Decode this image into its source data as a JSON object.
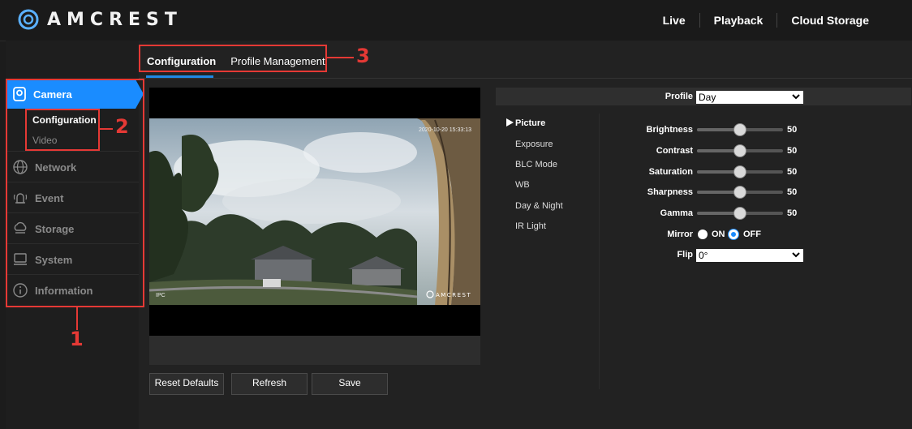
{
  "brand": {
    "name": "AMCREST"
  },
  "topnav": [
    {
      "label": "Live"
    },
    {
      "label": "Playback"
    },
    {
      "label": "Cloud Storage"
    }
  ],
  "subtabs": [
    {
      "label": "Configuration"
    },
    {
      "label": "Profile Management"
    }
  ],
  "sidebar": {
    "active": {
      "label": "Camera",
      "icon": "camera-icon"
    },
    "submenu": [
      {
        "label": "Configuration"
      },
      {
        "label": "Video"
      }
    ],
    "items": [
      {
        "label": "Network",
        "icon": "network-icon"
      },
      {
        "label": "Event",
        "icon": "event-icon"
      },
      {
        "label": "Storage",
        "icon": "storage-icon"
      },
      {
        "label": "System",
        "icon": "system-icon"
      },
      {
        "label": "Information",
        "icon": "info-icon"
      }
    ]
  },
  "video": {
    "timestamp": "2020-10-20 15:33:13",
    "channel": "IPC",
    "watermark": "AMCREST"
  },
  "buttons": {
    "reset": "Reset Defaults",
    "refresh": "Refresh",
    "save": "Save"
  },
  "profile": {
    "label": "Profile",
    "value": "Day"
  },
  "params": [
    {
      "label": "Picture"
    },
    {
      "label": "Exposure"
    },
    {
      "label": "BLC Mode"
    },
    {
      "label": "WB"
    },
    {
      "label": "Day & Night"
    },
    {
      "label": "IR Light"
    }
  ],
  "sliders": [
    {
      "label": "Brightness",
      "value": "50"
    },
    {
      "label": "Contrast",
      "value": "50"
    },
    {
      "label": "Saturation",
      "value": "50"
    },
    {
      "label": "Sharpness",
      "value": "50"
    },
    {
      "label": "Gamma",
      "value": "50"
    }
  ],
  "mirror": {
    "label": "Mirror",
    "on": "ON",
    "off": "OFF",
    "selected": "OFF"
  },
  "flip": {
    "label": "Flip",
    "value": "0°"
  },
  "annotations": [
    "1",
    "2",
    "3"
  ],
  "colors": {
    "accent": "#1a8cff",
    "annotation": "#e53935"
  }
}
